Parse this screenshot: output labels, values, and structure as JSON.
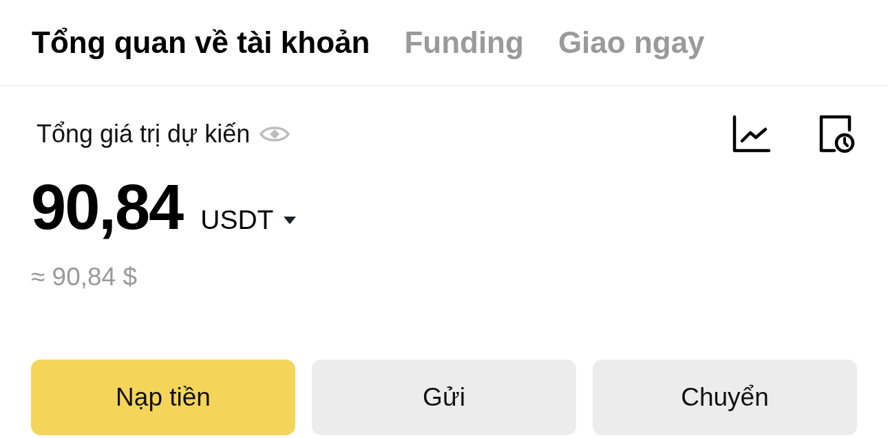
{
  "tabs": [
    {
      "label": "Tổng quan về tài khoản",
      "selected": true
    },
    {
      "label": "Funding",
      "selected": false
    },
    {
      "label": "Giao ngay",
      "selected": false
    }
  ],
  "balance": {
    "label": "Tổng giá trị dự kiến",
    "amount": "90,84",
    "currency": "USDT",
    "approx": "≈ 90,84 $"
  },
  "buttons": [
    {
      "label": "Nạp tiền",
      "kind": "primary"
    },
    {
      "label": "Gửi",
      "kind": "secondary"
    },
    {
      "label": "Chuyển",
      "kind": "secondary"
    }
  ]
}
